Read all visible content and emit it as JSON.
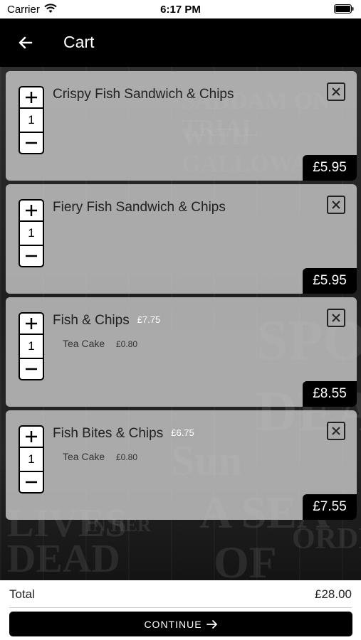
{
  "status_bar": {
    "carrier": "Carrier",
    "time": "6:17 PM"
  },
  "header": {
    "title": "Cart"
  },
  "cart": {
    "items": [
      {
        "name": "Crispy Fish Sandwich & Chips",
        "quantity": "1",
        "total": "£5.95"
      },
      {
        "name": "Fiery Fish Sandwich & Chips",
        "quantity": "1",
        "total": "£5.95"
      },
      {
        "name": "Fish & Chips",
        "base_price": "£7.75",
        "quantity": "1",
        "addon": {
          "name": "Tea Cake",
          "price": "£0.80"
        },
        "total": "£8.55"
      },
      {
        "name": "Fish Bites & Chips",
        "base_price": "£6.75",
        "quantity": "1",
        "addon": {
          "name": "Tea Cake",
          "price": "£0.80"
        },
        "total": "£7.55"
      }
    ]
  },
  "footer": {
    "total_label": "Total",
    "total_value": "£28.00",
    "continue_label": "CONTINUE"
  },
  "colors": {
    "app_bar": "#000000",
    "card": "#c8c8c8",
    "price_tag": "#000000",
    "pill": "#a9a9a9"
  },
  "icons": [
    "wifi-icon",
    "battery-icon",
    "back-arrow-icon",
    "plus-icon",
    "minus-icon",
    "close-icon",
    "arrow-right-icon"
  ]
}
